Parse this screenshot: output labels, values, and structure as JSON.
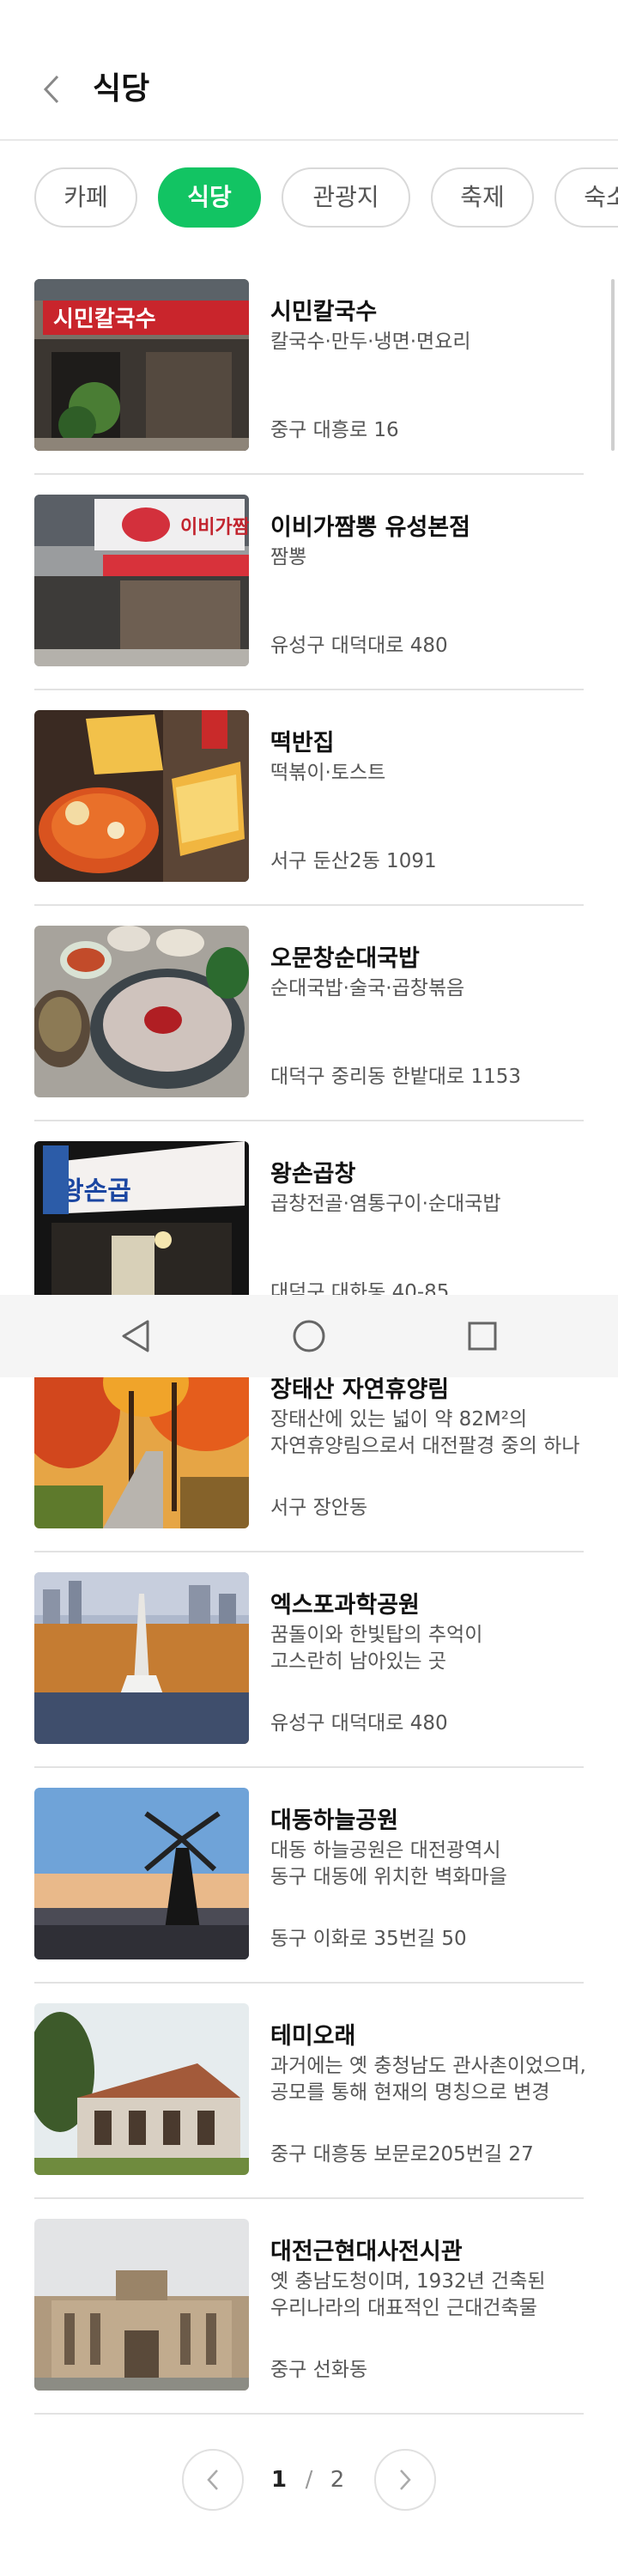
{
  "header": {
    "title": "식당"
  },
  "tabs": [
    {
      "label": "카페",
      "active": false
    },
    {
      "label": "식당",
      "active": true
    },
    {
      "label": "관광지",
      "active": false
    },
    {
      "label": "축제",
      "active": false
    },
    {
      "label": "숙소",
      "active": false
    }
  ],
  "items": [
    {
      "name": "시민칼국수",
      "desc": "칼국수·만두·냉면·면요리",
      "addr": "중구 대흥로 16",
      "sign": "시민칼국수"
    },
    {
      "name": "이비가짬뽕 유성본점",
      "desc": "짬뽕",
      "addr": "유성구 대덕대로 480",
      "sign": "이비가짬뽕"
    },
    {
      "name": "떡반집",
      "desc": "떡볶이·토스트",
      "addr": "서구 둔산2동 1091"
    },
    {
      "name": "오문창순대국밥",
      "desc": "순대국밥·술국·곱창볶음",
      "addr": "대덕구 중리동 한밭대로 1153"
    },
    {
      "name": "왕손곱창",
      "desc": "곱창전골·염통구이·순대국밥",
      "addr": "대덕구 대화동 40-85",
      "sign": "왕손곱"
    },
    {
      "name": "장태산 자연휴양림",
      "desc": "장태산에 있는 넓이 약 82M²의\n자연휴양림으로서 대전팔경 중의 하나",
      "addr": "서구 장안동"
    },
    {
      "name": "엑스포과학공원",
      "desc": "꿈돌이와 한빛탑의 추억이\n고스란히 남아있는 곳",
      "addr": "유성구 대덕대로 480"
    },
    {
      "name": "대동하늘공원",
      "desc": "대동 하늘공원은 대전광역시\n동구 대동에 위치한 벽화마을",
      "addr": "동구 이화로 35번길 50"
    },
    {
      "name": "테미오래",
      "desc": "과거에는 옛 충청남도 관사촌이었으며,\n공모를 통해 현재의 명칭으로 변경",
      "addr": "중구 대흥동 보문로205번길 27"
    },
    {
      "name": "대전근현대사전시관",
      "desc": "옛 충남도청이며, 1932년 건축된\n우리나라의 대표적인 근대건축물",
      "addr": "중구 선화동"
    }
  ],
  "pagination": {
    "current": "1",
    "separator": "/",
    "total": "2"
  },
  "icons": {
    "back": "chevron-left-icon",
    "nav_back": "triangle-back-icon",
    "nav_home": "circle-home-icon",
    "nav_recent": "square-recent-icon",
    "prev": "chevron-left-icon",
    "next": "chevron-right-icon"
  },
  "colors": {
    "accent": "#12c463",
    "divider": "#e2e2e2",
    "text": "#111111",
    "subtext": "#555555"
  }
}
